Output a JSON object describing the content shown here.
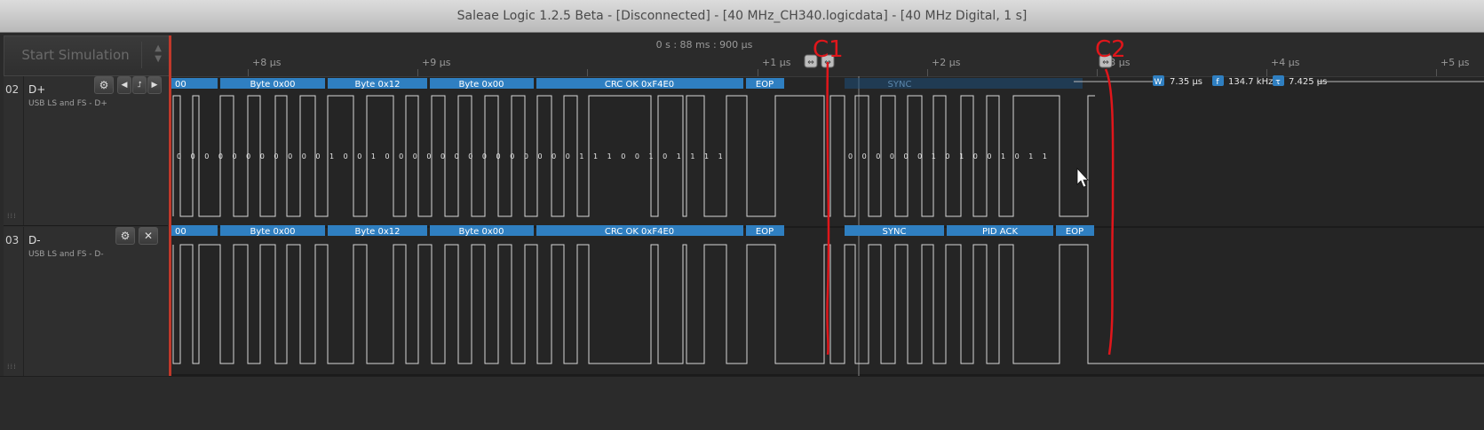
{
  "window": {
    "title": "Saleae Logic 1.2.5 Beta - [Disconnected] - [40 MHz_CH340.logicdata] - [40 MHz Digital, 1 s]"
  },
  "toolbar": {
    "start_label": "Start Simulation"
  },
  "ruler": {
    "time": "0 s : 88 ms : 900 µs",
    "ticks": [
      "+8 µs",
      "+9 µs",
      "+1 µs",
      "+2 µs",
      "+3 µs",
      "+4 µs",
      "+5 µs"
    ]
  },
  "channels": [
    {
      "num": "02",
      "name": "D+",
      "desc": "USB LS and FS - D+",
      "bits": "0 0 0 0 0 0 0 0 0 0 0 1 0 0 1 0 0 0 0 0 0 0 0 0 0 0 0 0 0 1 1 1 0 0 1 0 1 1 1 1",
      "bits2": "0 0 0 0 0 0 1 0 1 0 0 1 0 1 1",
      "frames": [
        "00",
        "Byte 0x00",
        "Byte 0x12",
        "Byte 0x00",
        "CRC OK 0xF4E0",
        "EOP",
        "SYNC"
      ]
    },
    {
      "num": "03",
      "name": "D-",
      "desc": "USB LS and FS - D-",
      "frames": [
        "00",
        "Byte 0x00",
        "Byte 0x12",
        "Byte 0x00",
        "CRC OK 0xF4E0",
        "EOP",
        "SYNC",
        "PID ACK",
        "EOP"
      ]
    }
  ],
  "measurement": {
    "w_label": "W",
    "w_value": "7.35 µs",
    "f_label": "f",
    "f_value": "134.7 kHz",
    "t_label": "τ",
    "t_value": "7.425 µs"
  },
  "annotations": {
    "c1": "C1",
    "c2": "C2"
  },
  "colors": {
    "frame_fill": "#2f7fc1",
    "annotation": "#e0161b",
    "wave": "#d8d8d8"
  }
}
